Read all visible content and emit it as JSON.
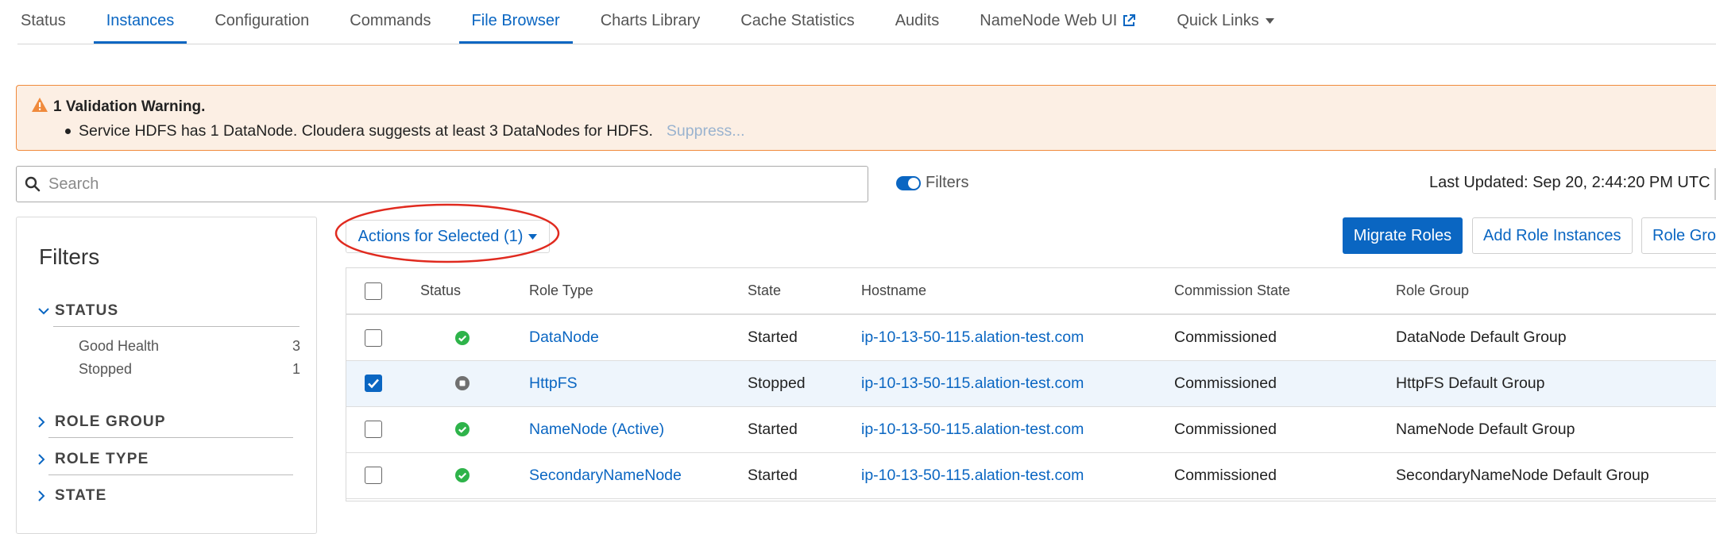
{
  "tabs": [
    {
      "label": "Status",
      "active": false
    },
    {
      "label": "Instances",
      "active": true
    },
    {
      "label": "Configuration",
      "active": false
    },
    {
      "label": "Commands",
      "active": false
    },
    {
      "label": "File Browser",
      "active": true
    },
    {
      "label": "Charts Library",
      "active": false
    },
    {
      "label": "Cache Statistics",
      "active": false
    },
    {
      "label": "Audits",
      "active": false
    },
    {
      "label": "NameNode Web UI",
      "active": false,
      "icon": "external-link-icon"
    },
    {
      "label": "Quick Links",
      "active": false,
      "icon": "caret-down-icon"
    }
  ],
  "warning": {
    "title": "1 Validation Warning.",
    "message": "Service HDFS has 1 DataNode. Cloudera suggests at least 3 DataNodes for HDFS.",
    "suppress_label": "Suppress...",
    "icon": "warning-triangle-icon"
  },
  "search": {
    "placeholder": "Search",
    "value": ""
  },
  "filters_toggle": {
    "label": "Filters",
    "on": true
  },
  "last_updated": "Last Updated: Sep 20, 2:44:20 PM UTC",
  "filters_panel": {
    "title": "Filters",
    "sections": [
      {
        "label": "STATUS",
        "expanded": true,
        "items": [
          {
            "label": "Good Health",
            "count": "3"
          },
          {
            "label": "Stopped",
            "count": "1"
          }
        ]
      },
      {
        "label": "ROLE GROUP",
        "expanded": false,
        "items": []
      },
      {
        "label": "ROLE TYPE",
        "expanded": false,
        "items": []
      },
      {
        "label": "STATE",
        "expanded": false,
        "items": []
      }
    ]
  },
  "toolbar": {
    "actions_label": "Actions for Selected (1)",
    "migrate_label": "Migrate Roles",
    "add_label": "Add Role Instances",
    "role_groups_label": "Role Groups"
  },
  "table": {
    "headers": [
      "Status",
      "Role Type",
      "State",
      "Hostname",
      "Commission State",
      "Role Group"
    ],
    "rows": [
      {
        "selected": false,
        "status": "good",
        "role_type": "DataNode",
        "state": "Started",
        "hostname": "ip-10-13-50-115.alation-test.com",
        "commission_state": "Commissioned",
        "role_group": "DataNode Default Group"
      },
      {
        "selected": true,
        "status": "stopped",
        "role_type": "HttpFS",
        "state": "Stopped",
        "hostname": "ip-10-13-50-115.alation-test.com",
        "commission_state": "Commissioned",
        "role_group": "HttpFS Default Group"
      },
      {
        "selected": false,
        "status": "good",
        "role_type": "NameNode (Active)",
        "state": "Started",
        "hostname": "ip-10-13-50-115.alation-test.com",
        "commission_state": "Commissioned",
        "role_group": "NameNode Default Group"
      },
      {
        "selected": false,
        "status": "good",
        "role_type": "SecondaryNameNode",
        "state": "Started",
        "hostname": "ip-10-13-50-115.alation-test.com",
        "commission_state": "Commissioned",
        "role_group": "SecondaryNameNode Default Group"
      }
    ]
  },
  "colors": {
    "accent": "#0a66c2",
    "warning_border": "#f08a3c",
    "warning_bg": "#fcefe4",
    "good_status": "#2eb34a",
    "stopped_status": "#707070",
    "highlight_ellipse": "#e02a1f"
  }
}
